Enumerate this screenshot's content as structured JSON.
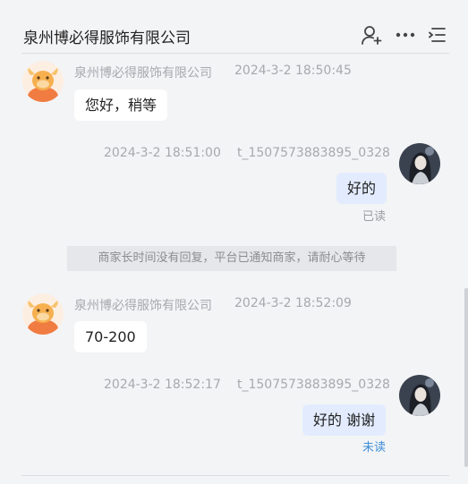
{
  "header": {
    "title": "泉州博必得服饰有限公司",
    "icons": [
      "add-contact-icon",
      "more-icon",
      "menu-list-icon"
    ]
  },
  "messages": [
    {
      "side": "left",
      "sender": "泉州博必得服饰有限公司",
      "time": "2024-3-2 18:50:45",
      "text": "您好，稍等"
    },
    {
      "side": "right",
      "sender": "t_1507573883895_0328",
      "time": "2024-3-2 18:51:00",
      "text": "好的",
      "status": "已读"
    },
    {
      "side": "left",
      "sender": "泉州博必得服饰有限公司",
      "time": "2024-3-2 18:52:09",
      "text": "70-200"
    },
    {
      "side": "right",
      "sender": "t_1507573883895_0328",
      "time": "2024-3-2 18:52:17",
      "text": "好的 谢谢",
      "status": "未读"
    }
  ],
  "system_notice": "商家长时间没有回复，平台已通知商家，请耐心等待",
  "colors": {
    "background": "#f3f4f6",
    "bubble_left": "#ffffff",
    "bubble_right": "#e3ecff",
    "unread": "#3f8ed8",
    "read": "#9a9ca1",
    "shop_avatar": "#f58b4c"
  }
}
